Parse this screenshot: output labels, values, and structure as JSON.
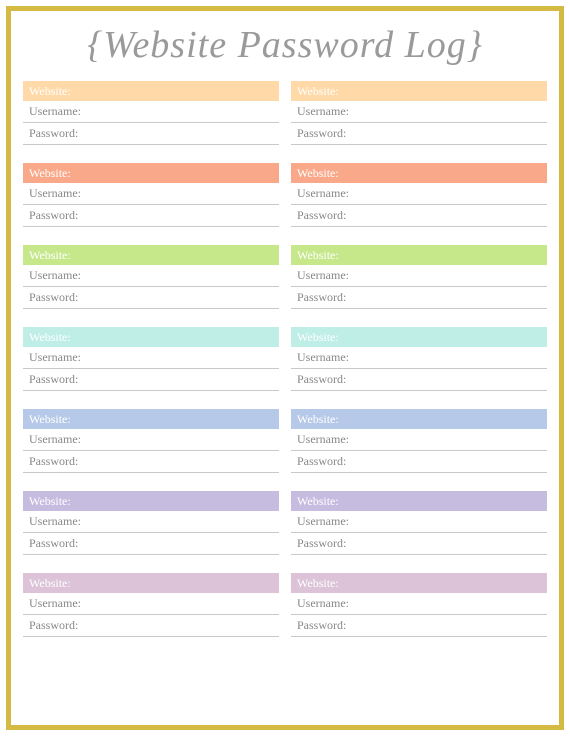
{
  "title": "{Website Password Log}",
  "labels": {
    "website": "Website:",
    "username": "Username:",
    "password": "Password:"
  },
  "rows": [
    {
      "color": "c0"
    },
    {
      "color": "c1"
    },
    {
      "color": "c2"
    },
    {
      "color": "c3"
    },
    {
      "color": "c4"
    },
    {
      "color": "c5"
    },
    {
      "color": "c6"
    }
  ]
}
